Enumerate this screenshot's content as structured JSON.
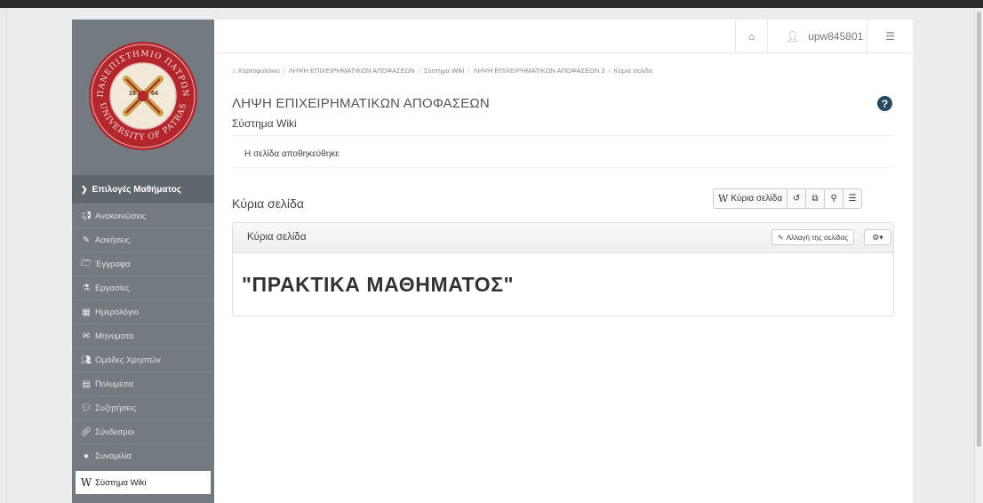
{
  "sidebar": {
    "logo": {
      "text_top": "ΠΑΝΕΠΙΣΤΗΜΙΟ ΠΑΤΡΩΝ",
      "text_bottom": "UNIVERSITY OF PATRAS",
      "year_left": "19",
      "year_right": "64"
    },
    "menu_header": "Επιλογές Μαθήματος",
    "items": [
      {
        "label": "Ανακοινώσεις",
        "icon": "bullhorn-icon"
      },
      {
        "label": "Ασκήσεις",
        "icon": "edit-icon"
      },
      {
        "label": "Έγγραφα",
        "icon": "folder-open-icon"
      },
      {
        "label": "Εργασίες",
        "icon": "flask-icon"
      },
      {
        "label": "Ημερολόγιο",
        "icon": "calendar-icon"
      },
      {
        "label": "Μηνύματα",
        "icon": "envelope-icon"
      },
      {
        "label": "Ομάδες Χρηστών",
        "icon": "users-icon"
      },
      {
        "label": "Πολυμέσα",
        "icon": "film-icon"
      },
      {
        "label": "Συζητήσεις",
        "icon": "comments-icon"
      },
      {
        "label": "Σύνδεσμοι",
        "icon": "link-icon"
      },
      {
        "label": "Συνομιλία",
        "icon": "chat-icon"
      },
      {
        "label": "Σύστημα Wiki",
        "icon": "wikipedia-icon",
        "active": true
      }
    ]
  },
  "header": {
    "username": "upw845801"
  },
  "breadcrumb": [
    "Χαρτοφυλάκιο",
    "ΛΗΨΗ ΕΠΙΧΕΙΡΗΜΑΤΙΚΩΝ ΑΠΟΦΑΣΕΩΝ",
    "Σύστημα Wiki",
    "ΛΗΨΗ ΕΠΙΧΕΙΡΗΜΑΤΙΚΩΝ ΑΠΟΦΑΣΕΩΝ 3",
    "Κύρια σελίδα"
  ],
  "course_title": "ΛΗΨΗ ΕΠΙΧΕΙΡΗΜΑΤΙΚΩΝ ΑΠΟΦΑΣΕΩΝ",
  "subtitle": "Σύστημα Wiki",
  "alert": "Η σελίδα αποθηκεύθηκε",
  "page_title": "Κύρια σελίδα",
  "toolbar": {
    "main_page_label": "Κύρια σελίδα"
  },
  "panel": {
    "title": "Κύρια σελίδα",
    "edit_label": "Αλλαγή της σελίδας",
    "heading": "\"ΠΡΑΚΤΙΚΑ ΜΑΘΗΜΑΤΟΣ\""
  },
  "colors": {
    "sidebar_bg": "#737a80",
    "menu_header_bg": "#5f666c",
    "help_icon": "#2a4a64"
  }
}
